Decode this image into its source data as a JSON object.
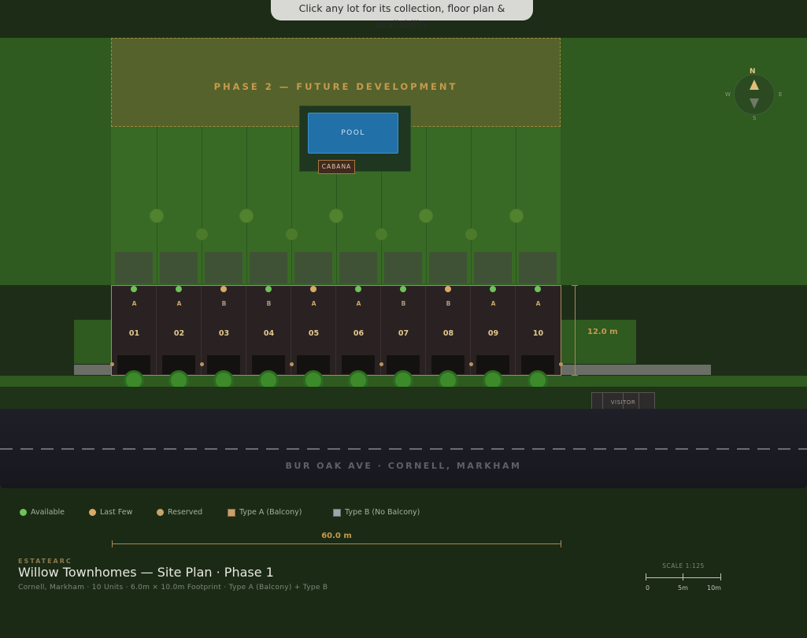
{
  "banner": {
    "hint": "Click any lot for its collection, floor plan & availability"
  },
  "phase2": {
    "label": "PHASE 2 — FUTURE DEVELOPMENT"
  },
  "amenity": {
    "pool": "POOL",
    "cabana": "CABANA"
  },
  "compass": {
    "n": "N",
    "s": "S",
    "w": "W",
    "e": "E"
  },
  "colors": {
    "available": "#6fc25a",
    "last_few": "#d9a968",
    "reserved": "#c9a469",
    "type_a_text": "#c9a86a",
    "type_b_text": "#a89c83"
  },
  "lots": [
    {
      "number": "01",
      "type": "A",
      "status": "available"
    },
    {
      "number": "02",
      "type": "A",
      "status": "available"
    },
    {
      "number": "03",
      "type": "B",
      "status": "last_few"
    },
    {
      "number": "04",
      "type": "B",
      "status": "available"
    },
    {
      "number": "05",
      "type": "A",
      "status": "last_few"
    },
    {
      "number": "06",
      "type": "A",
      "status": "available"
    },
    {
      "number": "07",
      "type": "B",
      "status": "available"
    },
    {
      "number": "08",
      "type": "B",
      "status": "last_few"
    },
    {
      "number": "09",
      "type": "A",
      "status": "available"
    },
    {
      "number": "10",
      "type": "A",
      "status": "available"
    }
  ],
  "dimensions": {
    "depth": "12.0 m",
    "width": "60.0 m"
  },
  "visitor": "VISITOR",
  "road": {
    "label": "BUR OAK AVE · CORNELL, MARKHAM"
  },
  "legend": {
    "available": "Available",
    "last_few": "Last Few",
    "reserved": "Reserved",
    "type_a": "Type A (Balcony)",
    "type_b": "Type B (No Balcony)"
  },
  "footer": {
    "brand": "ESTATEARC",
    "title": "Willow Townhomes — Site Plan · Phase 1",
    "subtitle": "Cornell, Markham · 10 Units · 6.0m × 10.0m Footprint · Type A (Balcony) + Type B"
  },
  "scale": {
    "label": "SCALE 1:125",
    "t0": "0",
    "t1": "5m",
    "t2": "10m"
  }
}
